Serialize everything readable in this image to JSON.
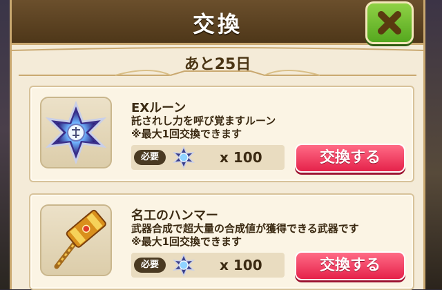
{
  "header": {
    "title": "交換"
  },
  "timer": {
    "text": "あと25日"
  },
  "items": [
    {
      "name": "EXルーン",
      "desc_line1": "託されし力を呼び覚ますルーン",
      "desc_line2": "※最大1回交換できます",
      "req_label": "必要",
      "req_count": "x 100",
      "button_label": "交換する",
      "icon": "ex-rune-icon"
    },
    {
      "name": "名工のハンマー",
      "desc_line1": "武器合成で超大量の合成値が獲得できる武器です",
      "desc_line2": "※最大1回交換できます",
      "req_label": "必要",
      "req_count": "x 100",
      "button_label": "交換する",
      "icon": "master-hammer-icon"
    }
  ],
  "colors": {
    "header_bg": "#5a3f1f",
    "close_button": "#6fbf2e",
    "exchange_button": "#f0355a",
    "panel_bg": "#f4ebd8"
  }
}
